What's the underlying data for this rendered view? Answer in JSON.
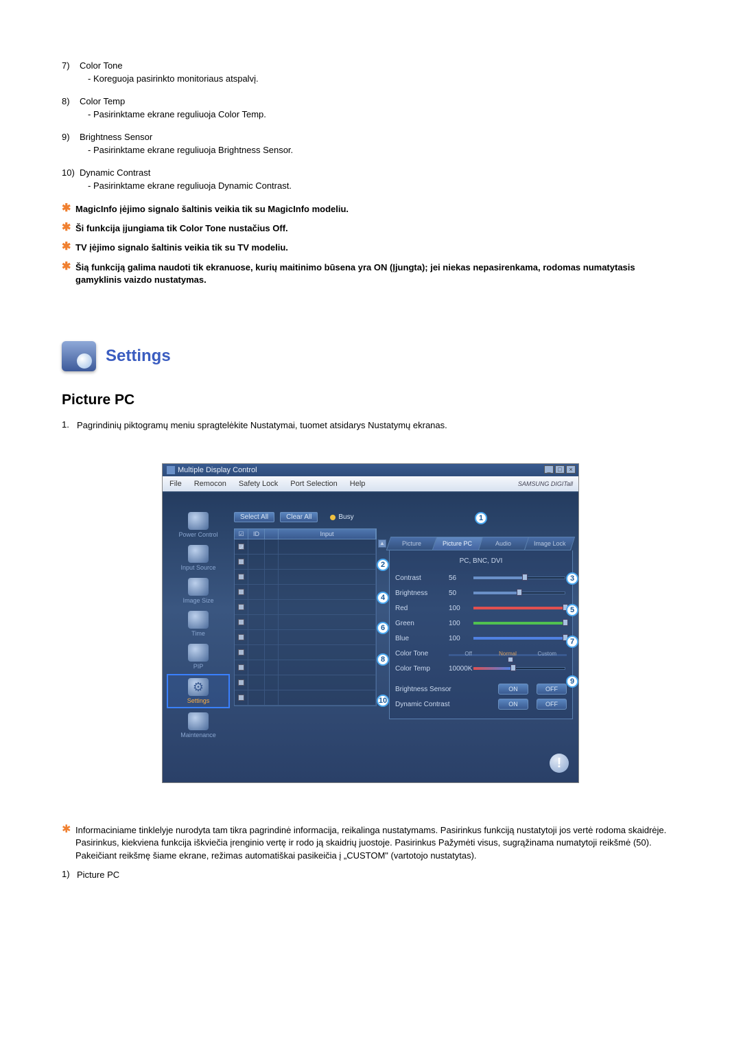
{
  "list": [
    {
      "num": "7)",
      "title": "Color Tone",
      "desc": "- Koreguoja pasirinkto monitoriaus atspalvį."
    },
    {
      "num": "8)",
      "title": "Color Temp",
      "desc": "- Pasirinktame ekrane reguliuoja Color Temp."
    },
    {
      "num": "9)",
      "title": "Brightness Sensor",
      "desc": "- Pasirinktame ekrane reguliuoja Brightness Sensor."
    },
    {
      "num": "10)",
      "title": "Dynamic Contrast",
      "desc": "- Pasirinktame ekrane reguliuoja Dynamic Contrast."
    }
  ],
  "stars": [
    "MagicInfo įėjimo signalo šaltinis veikia tik su MagicInfo modeliu.",
    "Ši funkcija įjungiama tik Color Tone nustačius Off.",
    "TV įėjimo signalo šaltinis veikia tik su TV modeliu.",
    "Šią funkciją galima naudoti tik ekranuose, kurių maitinimo būsena yra ON (Įjungta); jei niekas nepasirenkama, rodomas numatytasis gamyklinis vaizdo nustatymas."
  ],
  "settings_title": "Settings",
  "sub_title": "Picture PC",
  "sub_rows": [
    {
      "n": "1.",
      "t": "Pagrindinių piktogramų meniu spragtelėkite Nustatymai, tuomet atsidarys Nustatymų ekranas."
    }
  ],
  "app": {
    "win_title": "Multiple Display Control",
    "menu": [
      "File",
      "Remocon",
      "Safety Lock",
      "Port Selection",
      "Help"
    ],
    "logo": "SAMSUNG DIGITall",
    "sidebar": [
      {
        "label": "Power Control",
        "sel": false
      },
      {
        "label": "Input Source",
        "sel": false
      },
      {
        "label": "Image Size",
        "sel": false
      },
      {
        "label": "Time",
        "sel": false
      },
      {
        "label": "PIP",
        "sel": false
      },
      {
        "label": "Settings",
        "sel": true
      },
      {
        "label": "Maintenance",
        "sel": false
      }
    ],
    "toolbar": {
      "select_all": "Select All",
      "clear_all": "Clear All",
      "busy": "Busy"
    },
    "grid_head": {
      "c1": "☑",
      "c2": "ID",
      "c3": "",
      "c4": "Input"
    },
    "grid_rows": 11,
    "grid_first_checked": true,
    "tabs": [
      {
        "label": "Picture",
        "active": false
      },
      {
        "label": "Picture PC",
        "active": true
      },
      {
        "label": "Audio",
        "active": false
      },
      {
        "label": "Image Lock",
        "active": false
      }
    ],
    "mode": "PC, BNC, DVI",
    "sliders": [
      {
        "label": "Contrast",
        "val": "56",
        "pct": 56,
        "fill": "#6a90c8"
      },
      {
        "label": "Brightness",
        "val": "50",
        "pct": 50,
        "fill": "#6a90c8"
      },
      {
        "label": "Red",
        "val": "100",
        "pct": 100,
        "fill": "#e05050"
      },
      {
        "label": "Green",
        "val": "100",
        "pct": 100,
        "fill": "#50c050"
      },
      {
        "label": "Blue",
        "val": "100",
        "pct": 100,
        "fill": "#5080e0"
      }
    ],
    "color_tone": {
      "label": "Color Tone",
      "opts": [
        "Off",
        "Normal",
        "Custom"
      ],
      "sel": 1
    },
    "color_temp": {
      "label": "Color Temp",
      "val": "10000K",
      "pct": 40
    },
    "toggles": [
      {
        "label": "Brightness Sensor",
        "on": "ON",
        "off": "OFF"
      },
      {
        "label": "Dynamic Contrast",
        "on": "ON",
        "off": "OFF"
      }
    ],
    "callouts": [
      "1",
      "2",
      "3",
      "4",
      "5",
      "6",
      "7",
      "8",
      "9",
      "10"
    ]
  },
  "bottom_star": "Informaciniame tinklelyje nurodyta tam tikra pagrindinė informacija, reikalinga nustatymams. Pasirinkus funkciją nustatytoji jos vertė rodoma skaidrėje. Pasirinkus, kiekviena funkcija iškviečia įrenginio vertę ir rodo ją skaidrių juostoje. Pasirinkus Pažymėti visus, sugrąžinama numatytoji reikšmė (50). Pakeičiant reikšmę šiame ekrane, režimas automatiškai pasikeičia į „CUSTOM\" (vartotojo nustatytas).",
  "bottom_item": {
    "n": "1)",
    "t": "Picture PC"
  }
}
